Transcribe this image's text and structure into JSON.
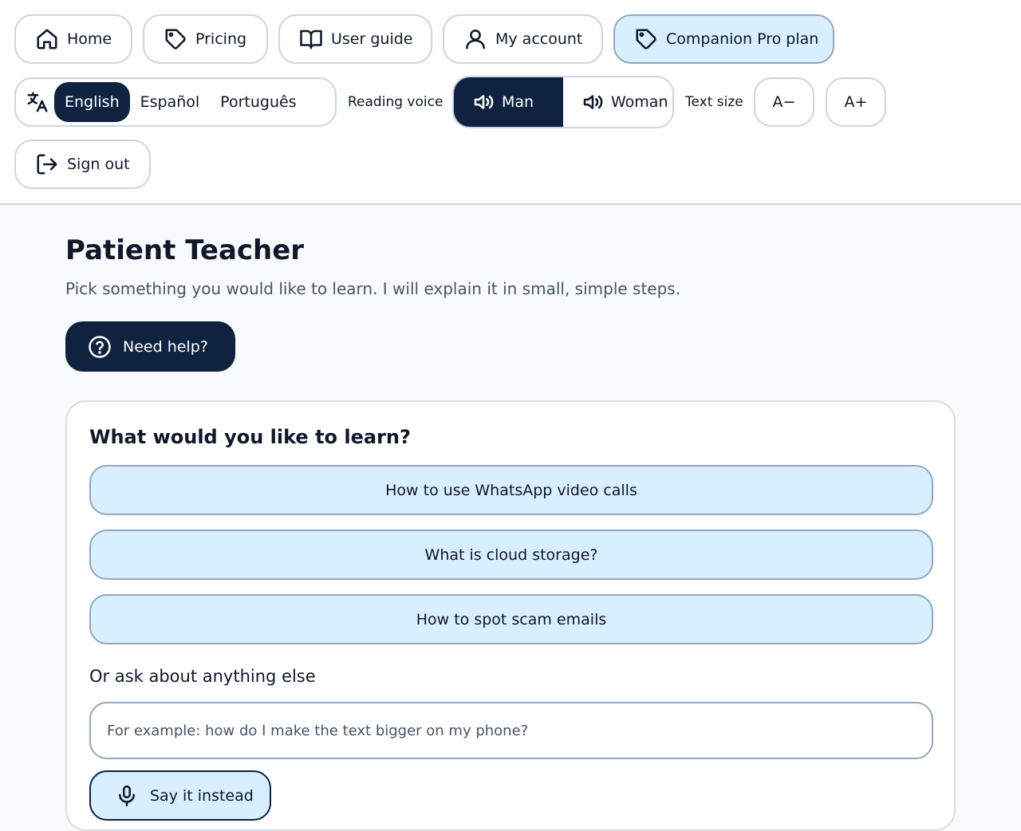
{
  "nav": {
    "home": "Home",
    "pricing": "Pricing",
    "user_guide": "User guide",
    "my_account": "My account",
    "plan": "Companion Pro plan",
    "sign_out": "Sign out"
  },
  "language": {
    "options": [
      "English",
      "Español",
      "Português"
    ],
    "selected": "English"
  },
  "voice": {
    "label": "Reading voice",
    "options": [
      "Man",
      "Woman"
    ],
    "selected": "Man"
  },
  "text_size": {
    "label": "Text size",
    "decrease": "A−",
    "increase": "A+"
  },
  "main": {
    "title": "Patient Teacher",
    "subtitle": "Pick something you would like to learn. I will explain it in small, simple steps.",
    "help_label": "Need help?"
  },
  "learn": {
    "title": "What would you like to learn?",
    "topics": [
      "How to use WhatsApp video calls",
      "What is cloud storage?",
      "How to spot scam emails"
    ],
    "ask_label": "Or ask about anything else",
    "ask_placeholder": "For example: how do I make the text bigger on my phone?",
    "say_label": "Say it instead"
  },
  "colors": {
    "accent_dark": "#0f2341",
    "accent_light": "#d7efff",
    "border": "#cbd5e1"
  }
}
